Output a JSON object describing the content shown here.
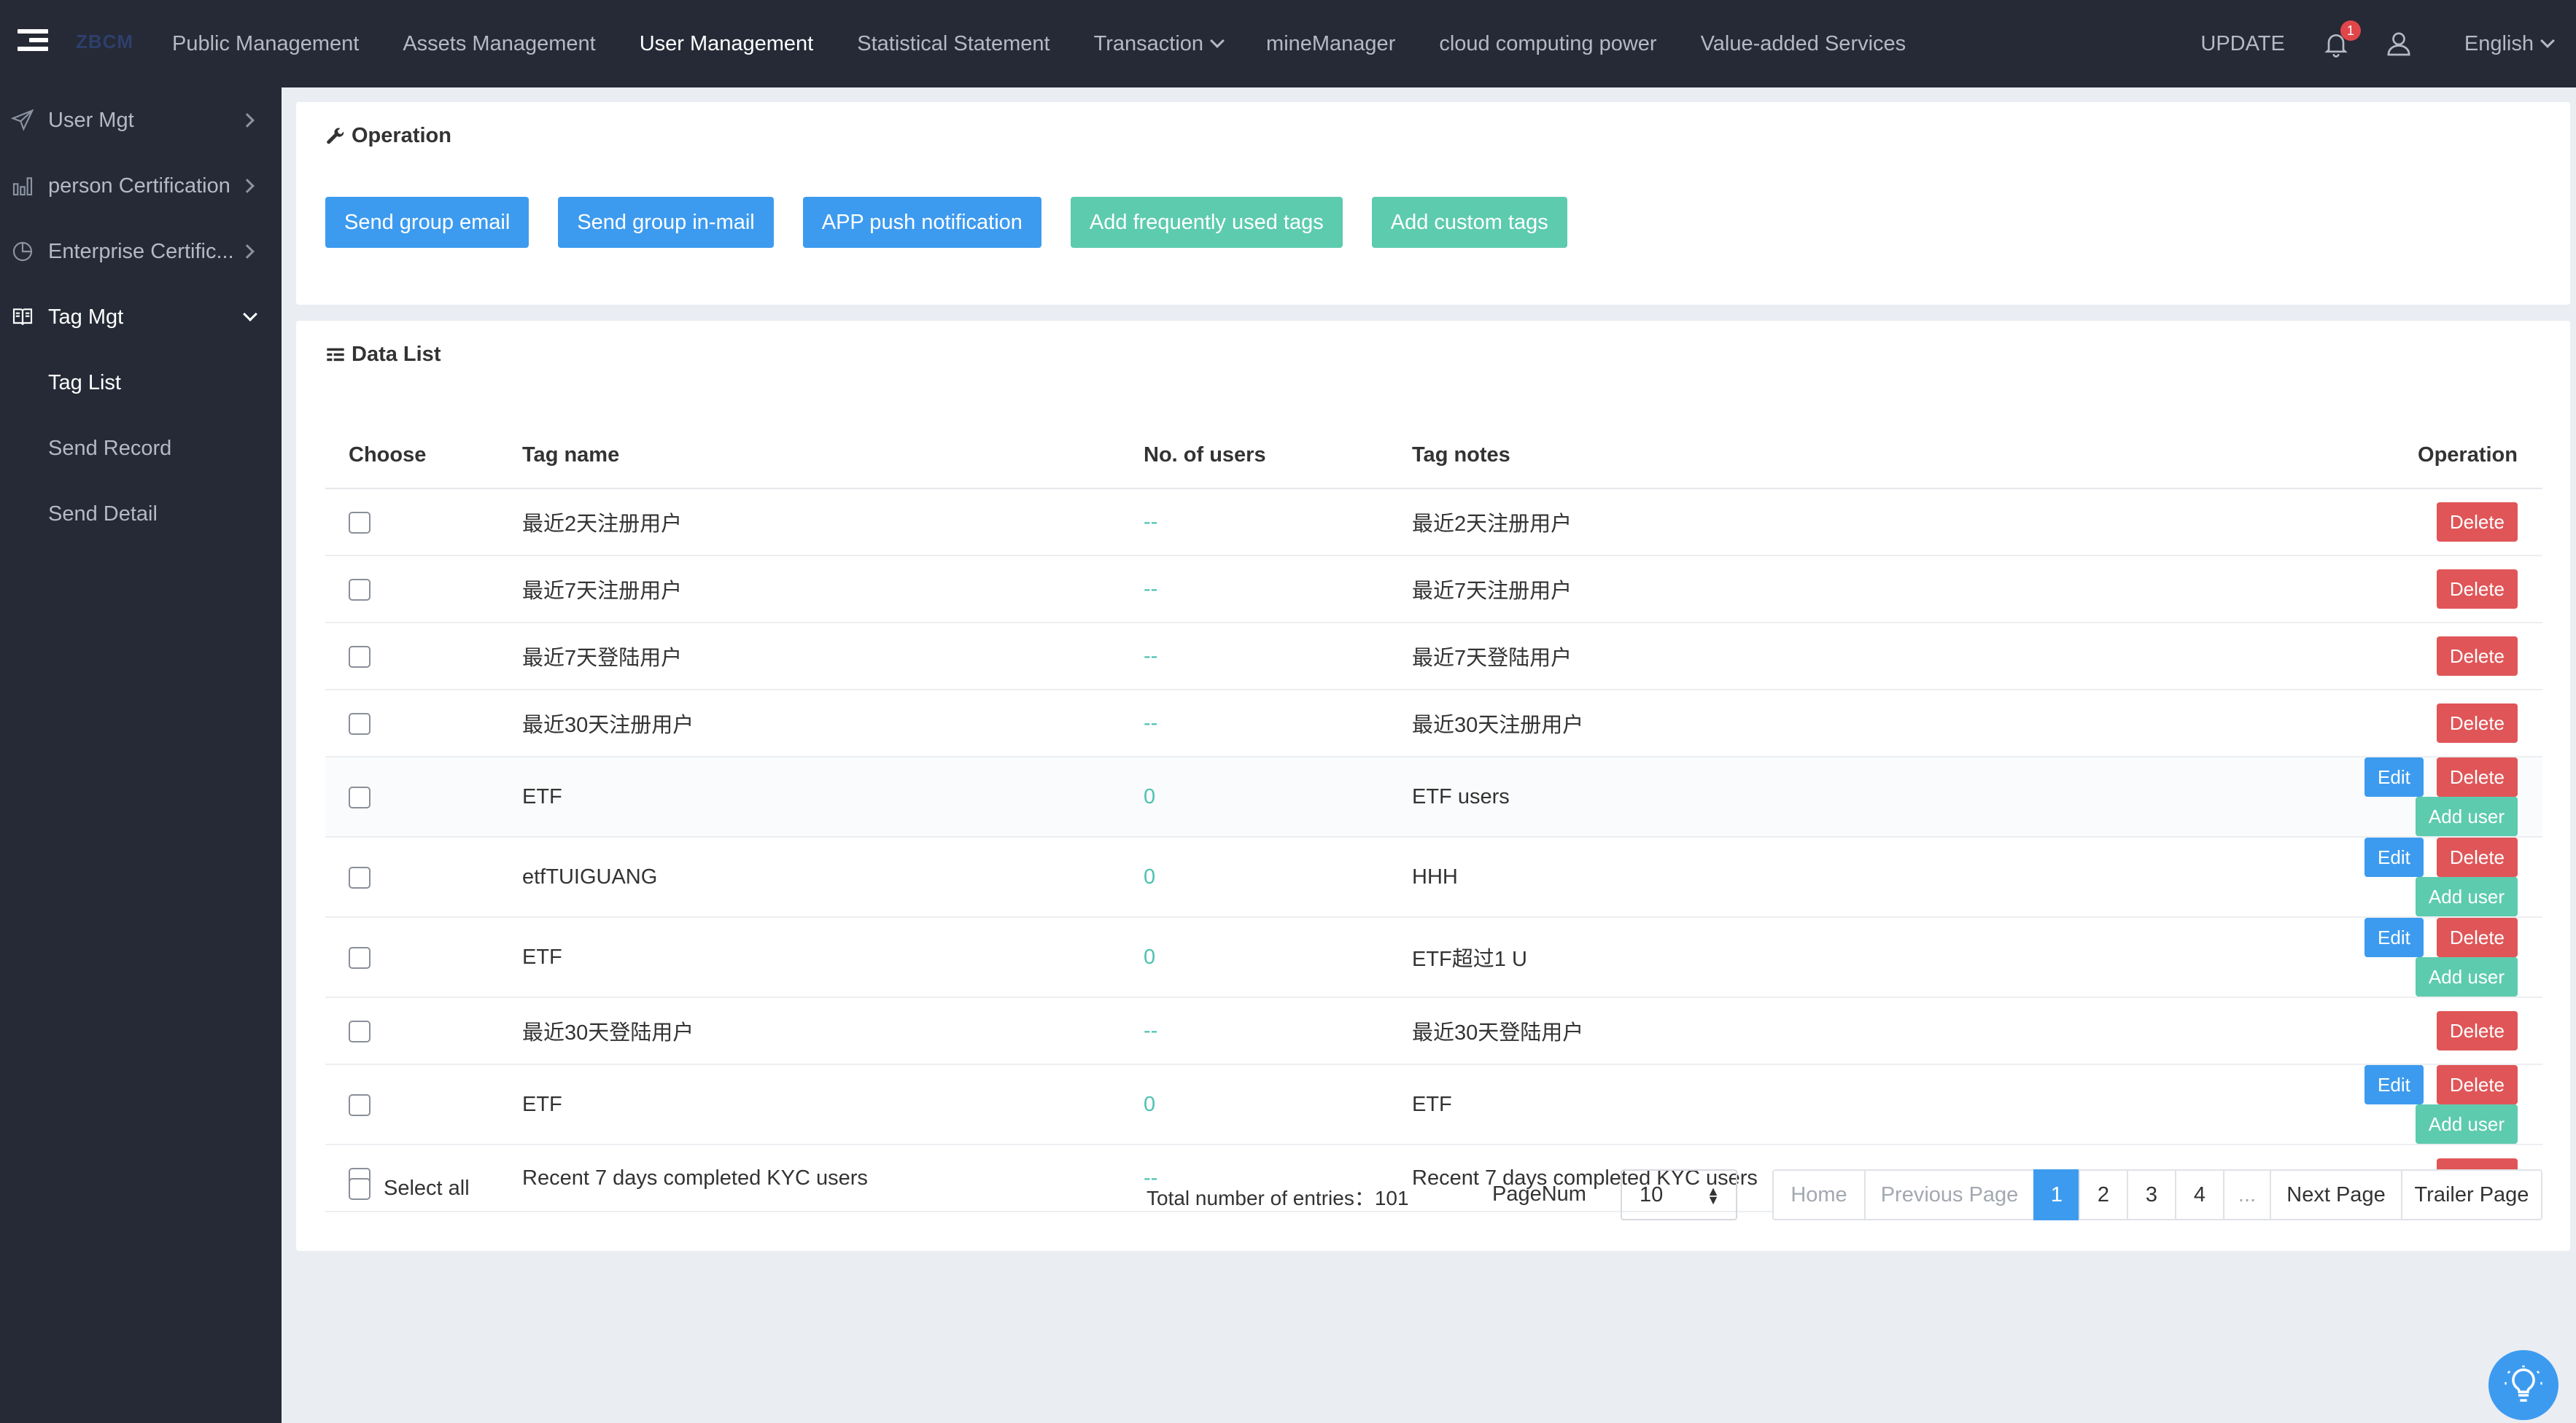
{
  "header": {
    "logo": "ZBCM",
    "nav": [
      {
        "label": "Public Management",
        "active": false,
        "dropdown": false
      },
      {
        "label": "Assets Management",
        "active": false,
        "dropdown": false
      },
      {
        "label": "User Management",
        "active": true,
        "dropdown": false
      },
      {
        "label": "Statistical Statement",
        "active": false,
        "dropdown": false
      },
      {
        "label": "Transaction",
        "active": false,
        "dropdown": true
      },
      {
        "label": "mineManager",
        "active": false,
        "dropdown": false
      },
      {
        "label": "cloud computing power",
        "active": false,
        "dropdown": false
      },
      {
        "label": "Value-added Services",
        "active": false,
        "dropdown": false
      }
    ],
    "update_label": "UPDATE",
    "notification_count": "1",
    "language": "English"
  },
  "sidebar": {
    "items": [
      {
        "label": "User Mgt",
        "icon": "send-icon"
      },
      {
        "label": "person Certification",
        "icon": "bar-chart-icon"
      },
      {
        "label": "Enterprise Certific...",
        "icon": "pie-chart-icon"
      },
      {
        "label": "Tag Mgt",
        "icon": "book-icon",
        "open": true
      }
    ],
    "subitems": [
      {
        "label": "Tag List",
        "active": true
      },
      {
        "label": "Send Record",
        "active": false
      },
      {
        "label": "Send Detail",
        "active": false
      }
    ]
  },
  "operation": {
    "title": "Operation",
    "buttons": [
      {
        "label": "Send group email",
        "color": "#3d9bef"
      },
      {
        "label": "Send group in-mail",
        "color": "#3d9bef"
      },
      {
        "label": "APP push notification",
        "color": "#3d9bef"
      },
      {
        "label": "Add frequently used tags",
        "color": "#5dcbae"
      },
      {
        "label": "Add custom tags",
        "color": "#5dcbae"
      }
    ]
  },
  "data_list": {
    "title": "Data List",
    "columns": {
      "choose": "Choose",
      "name": "Tag name",
      "users": "No. of users",
      "notes": "Tag notes",
      "operation": "Operation"
    },
    "actions": {
      "edit": "Edit",
      "delete": "Delete",
      "add_user": "Add user"
    },
    "rows": [
      {
        "name": "最近2天注册用户",
        "users": "--",
        "notes": "最近2天注册用户",
        "editable": false
      },
      {
        "name": "最近7天注册用户",
        "users": "--",
        "notes": "最近7天注册用户",
        "editable": false
      },
      {
        "name": "最近7天登陆用户",
        "users": "--",
        "notes": "最近7天登陆用户",
        "editable": false
      },
      {
        "name": "最近30天注册用户",
        "users": "--",
        "notes": "最近30天注册用户",
        "editable": false
      },
      {
        "name": "ETF",
        "users": "0",
        "notes": "ETF users",
        "editable": true
      },
      {
        "name": "etfTUIGUANG",
        "users": "0",
        "notes": "HHH",
        "editable": true
      },
      {
        "name": "ETF",
        "users": "0",
        "notes": "ETF超过1 U",
        "editable": true
      },
      {
        "name": "最近30天登陆用户",
        "users": "--",
        "notes": "最近30天登陆用户",
        "editable": false
      },
      {
        "name": "ETF",
        "users": "0",
        "notes": "ETF",
        "editable": true
      },
      {
        "name": "Recent 7 days completed KYC users",
        "users": "--",
        "notes": "Recent 7 days completed KYC users",
        "editable": false
      }
    ],
    "footer": {
      "select_all": "Select all",
      "total_label": "Total number of entries：101",
      "pagenum_label": "PageNum",
      "page_size": "10",
      "pager": {
        "home": "Home",
        "previous": "Previous Page",
        "pages": [
          "1",
          "2",
          "3",
          "4",
          "..."
        ],
        "current": "1",
        "next": "Next Page",
        "trailer": "Trailer Page"
      }
    }
  },
  "colors": {
    "nav_bg": "#252a36",
    "primary": "#3d9bef",
    "teal": "#5dcbae",
    "danger": "#e05557"
  }
}
